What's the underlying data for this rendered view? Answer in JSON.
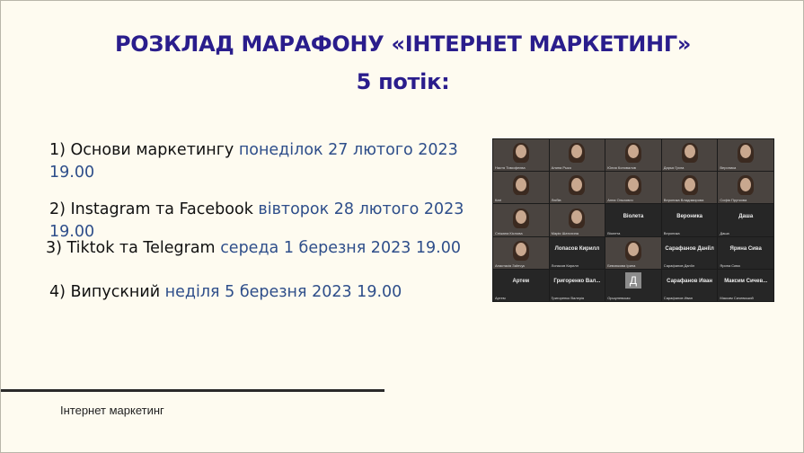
{
  "slide": {
    "title_line1": "РОЗКЛАД МАРАФОНУ «ІНТЕРНЕТ МАРКЕТИНГ»",
    "title_line2": "5 потік:",
    "items": [
      {
        "label": "1)   Основи маркетингу",
        "date_line1": "понеділок 27 лютого 2023",
        "date_line2": "19.00"
      },
      {
        "label": "2) Instagram та Facebook",
        "date_line1": "вівторок 28 лютого 2023",
        "date_line2": "19.00"
      },
      {
        "label": "3) Tiktok та Telegram",
        "date_line1": "середа 1 березня 2023 19.00"
      },
      {
        "label": "4) Випускний",
        "date_line1": "неділя 5 березня 2023 19.00"
      }
    ],
    "footer": "Інтернет маркетинг"
  },
  "zoom_grid": {
    "tiles": [
      {
        "type": "video",
        "name": "Настя Тимофеєва"
      },
      {
        "type": "video",
        "name": "Алина Рыко"
      },
      {
        "type": "video",
        "name": "Юлия Коновалов"
      },
      {
        "type": "video",
        "name": "Дарья Грига"
      },
      {
        "type": "video",
        "name": "Вероника"
      },
      {
        "type": "video",
        "name": "Каті"
      },
      {
        "type": "video",
        "name": "Любів"
      },
      {
        "type": "video",
        "name": "Анна Ольхович"
      },
      {
        "type": "video",
        "name": "Вероника Владимирова"
      },
      {
        "type": "video",
        "name": "Софія Пруткова"
      },
      {
        "type": "video",
        "name": "Сніжана Кіслова"
      },
      {
        "type": "video",
        "name": "Марія Шатохина"
      },
      {
        "type": "name",
        "big": "Віолета",
        "name": "Віолета"
      },
      {
        "type": "name",
        "big": "Вероника",
        "name": "Вероника"
      },
      {
        "type": "name",
        "big": "Даша",
        "name": "Даша"
      },
      {
        "type": "video",
        "name": "Анастасія Заїнчук"
      },
      {
        "type": "name",
        "big": "Лопасов Кирилл",
        "name": "Лопасов Кирилл"
      },
      {
        "type": "video",
        "name": "Бевзюкова Ірина"
      },
      {
        "type": "name",
        "big": "Сарафанов Даніїл",
        "name": "Сарафанов Даніїл"
      },
      {
        "type": "name",
        "big": "Ярина Сива",
        "name": "Ярина Сива"
      },
      {
        "type": "name",
        "big": "Артем",
        "name": "Артем"
      },
      {
        "type": "name",
        "big": "Григоренко Вал...",
        "name": "Григоренко Валерія"
      },
      {
        "type": "letter",
        "letter": "Д",
        "name": "Оршулевская"
      },
      {
        "type": "name",
        "big": "Сарафанов Иван",
        "name": "Сарафанов Иван"
      },
      {
        "type": "name",
        "big": "Максим Сичев...",
        "name": "Максим Сичевський"
      }
    ]
  }
}
